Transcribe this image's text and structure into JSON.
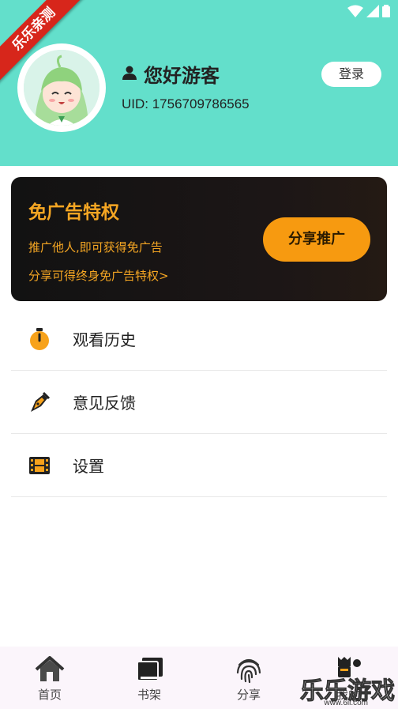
{
  "ribbon": {
    "text": "乐乐亲测"
  },
  "profile": {
    "greeting": "您好游客",
    "uid": "UID: 1756709786565",
    "login_label": "登录"
  },
  "promo": {
    "title": "免广告特权",
    "line1": "推广他人,即可获得免广告",
    "line2": "分享可得终身免广告特权>",
    "button_label": "分享推广"
  },
  "menu": {
    "items": [
      {
        "label": "观看历史",
        "icon": "stopwatch-icon"
      },
      {
        "label": "意见反馈",
        "icon": "pen-nib-icon"
      },
      {
        "label": "设置",
        "icon": "film-icon"
      }
    ]
  },
  "tabs": [
    {
      "label": "首页",
      "icon": "home-icon"
    },
    {
      "label": "书架",
      "icon": "books-icon"
    },
    {
      "label": "分享",
      "icon": "fingerprint-icon"
    },
    {
      "label": "我的",
      "icon": "mine-icon"
    }
  ],
  "watermark": {
    "text": "乐乐游戏",
    "url": "www.6il.com"
  },
  "colors": {
    "header": "#63dfcb",
    "accent": "#f5a623",
    "button": "#f79a10"
  }
}
